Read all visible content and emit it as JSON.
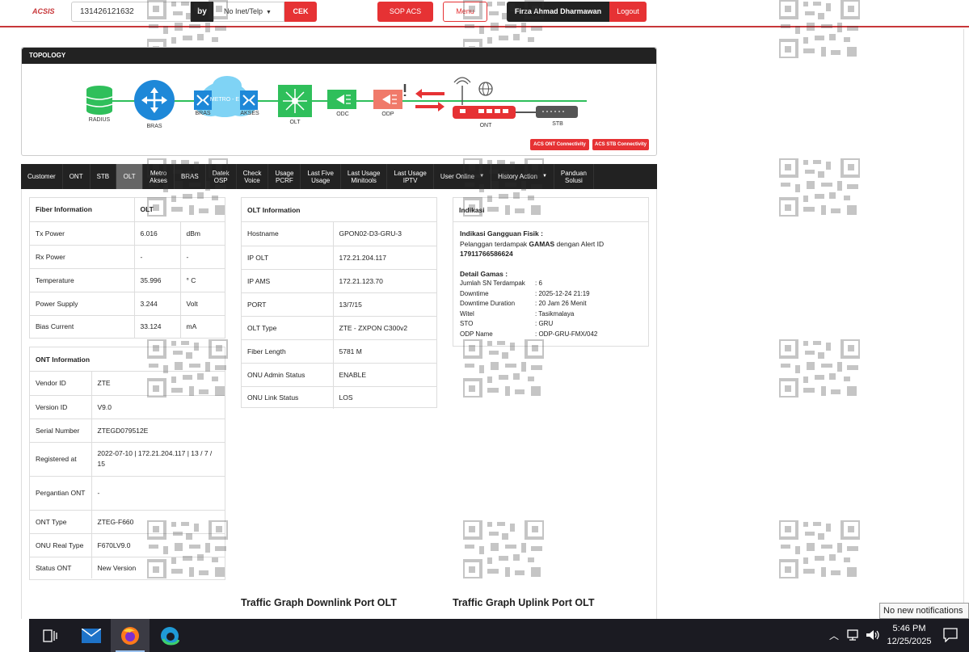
{
  "header": {
    "logo": "ACSIS",
    "search_value": "131426121632",
    "by_label": "by",
    "search_type": "No Inet/Telp",
    "cek_label": "CEK",
    "sop_label": "SOP ACS",
    "menu_label": "Menu",
    "user_name": "Firza Ahmad Dharmawan",
    "logout_label": "Logout"
  },
  "topology": {
    "title": "TOPOLOGY",
    "nodes": {
      "radius": "RADIUS",
      "bras": "BRAS",
      "bras2": "BRAS",
      "metro": "METRO - E",
      "akses": "AKSES",
      "olt": "OLT",
      "odc": "ODC",
      "odp": "ODP",
      "ont": "ONT",
      "stb": "STB"
    },
    "acs_ont_btn": "ACS ONT Connectivity",
    "acs_stb_btn": "ACS STB Connectivity"
  },
  "tabs": [
    {
      "l1": "Customer",
      "l2": ""
    },
    {
      "l1": "ONT",
      "l2": ""
    },
    {
      "l1": "STB",
      "l2": ""
    },
    {
      "l1": "OLT",
      "l2": ""
    },
    {
      "l1": "Metro",
      "l2": "Akses"
    },
    {
      "l1": "BRAS",
      "l2": ""
    },
    {
      "l1": "Datek",
      "l2": "OSP"
    },
    {
      "l1": "Check",
      "l2": "Voice"
    },
    {
      "l1": "Usage",
      "l2": "PCRF"
    },
    {
      "l1": "Last Five",
      "l2": "Usage"
    },
    {
      "l1": "Last Usage",
      "l2": "Minitools"
    },
    {
      "l1": "Last Usage",
      "l2": "IPTV"
    },
    {
      "l1": "User Online",
      "l2": ""
    },
    {
      "l1": "History Action",
      "l2": ""
    },
    {
      "l1": "Panduan",
      "l2": "Solusi"
    }
  ],
  "fiber": {
    "col1": "Fiber Information",
    "col2": "OLT",
    "rows": [
      {
        "label": "Tx Power",
        "value": "6.016",
        "unit": "dBm"
      },
      {
        "label": "Rx Power",
        "value": "-",
        "unit": "-"
      },
      {
        "label": "Temperature",
        "value": "35.996",
        "unit": "° C"
      },
      {
        "label": "Power Supply",
        "value": "3.244",
        "unit": "Volt"
      },
      {
        "label": "Bias Current",
        "value": "33.124",
        "unit": "mA"
      }
    ]
  },
  "ont": {
    "title": "ONT Information",
    "rows": [
      {
        "label": "Vendor ID",
        "value": "ZTE"
      },
      {
        "label": "Version ID",
        "value": "V9.0"
      },
      {
        "label": "Serial Number",
        "value": "ZTEGD079512E"
      },
      {
        "label": "Registered at",
        "value": "2022-07-10 | 172.21.204.117 | 13 / 7 / 15"
      },
      {
        "label": "Pergantian ONT",
        "value": "-"
      },
      {
        "label": "ONT Type",
        "value": "ZTEG-F660"
      },
      {
        "label": "ONU Real Type",
        "value": "F670LV9.0"
      },
      {
        "label": "Status ONT",
        "value": "New Version"
      }
    ]
  },
  "olt": {
    "title": "OLT Information",
    "rows": [
      {
        "label": "Hostname",
        "value": "GPON02-D3-GRU-3"
      },
      {
        "label": "IP OLT",
        "value": "172.21.204.117"
      },
      {
        "label": "IP AMS",
        "value": "172.21.123.70"
      },
      {
        "label": "PORT",
        "value": "13/7/15"
      },
      {
        "label": "OLT Type",
        "value": "ZTE - ZXPON C300v2"
      },
      {
        "label": "Fiber Length",
        "value": "5781 M"
      },
      {
        "label": "ONU Admin Status",
        "value": "ENABLE"
      },
      {
        "label": "ONU Link Status",
        "value": "LOS"
      }
    ]
  },
  "indikasi": {
    "title": "Indikasi",
    "fisik_title": "Indikasi Gangguan Fisik :",
    "alert_pre": "Pelanggan terdampak ",
    "alert_bold": "GAMAS",
    "alert_post": " dengan Alert ID",
    "alert_id": "17911766586624",
    "detail_title": "Detail Gamas :",
    "details": [
      {
        "k": "Jumlah SN Terdampak",
        "v": ": 6"
      },
      {
        "k": "Downtime",
        "v": ": 2025-12-24 21:19"
      },
      {
        "k": "Downtime Duration",
        "v": ": 20 Jam 26 Menit"
      },
      {
        "k": "Witel",
        "v": ": Tasikmalaya"
      },
      {
        "k": "STO",
        "v": ": GRU"
      },
      {
        "k": "ODP Name",
        "v": ": ODP-GRU-FMX/042"
      }
    ]
  },
  "graphs": {
    "downlink": "Traffic Graph Downlink Port OLT",
    "uplink": "Traffic Graph Uplink Port OLT"
  },
  "taskbar": {
    "time": "5:46 PM",
    "date": "12/25/2025",
    "notification": "No new notifications"
  },
  "colors": {
    "accent": "#e63234",
    "dark": "#222222",
    "node_green": "#2fbf5b",
    "node_blue": "#1e88d8"
  }
}
